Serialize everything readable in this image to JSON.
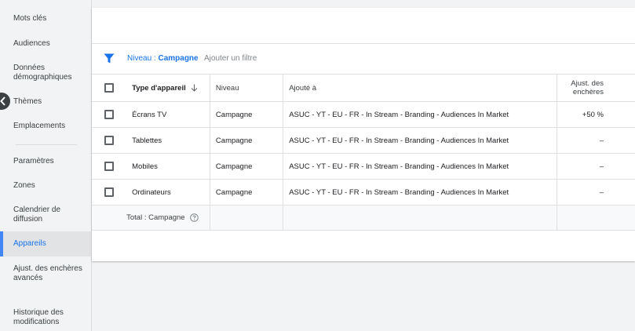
{
  "sidebar": {
    "items": [
      {
        "label": "Mots clés"
      },
      {
        "label": "Audiences"
      },
      {
        "label": "Données démographiques"
      },
      {
        "label": "Thèmes"
      },
      {
        "label": "Emplacements"
      },
      {
        "label": "Paramètres"
      },
      {
        "label": "Zones"
      },
      {
        "label": "Calendrier de diffusion"
      },
      {
        "label": "Appareils"
      },
      {
        "label": "Ajust. des enchères avancés"
      },
      {
        "label": "Historique des modifications"
      }
    ],
    "active": "Appareils",
    "accent_color": "#4285f4"
  },
  "filter": {
    "level_prefix": "Niveau : ",
    "level_value": "Campagne",
    "add_filter": "Ajouter un filtre",
    "icon": "filter-icon"
  },
  "table": {
    "headers": {
      "type": "Type d'appareil",
      "level": "Niveau",
      "added": "Ajouté à",
      "adjust": "Ajust. des enchères"
    },
    "rows": [
      {
        "type": "Écrans TV",
        "level": "Campagne",
        "added": "ASUC - YT - EU - FR - In Stream - Branding - Audiences In Market",
        "adjust": "+50 %"
      },
      {
        "type": "Tablettes",
        "level": "Campagne",
        "added": "ASUC - YT - EU - FR - In Stream - Branding - Audiences In Market",
        "adjust": "–"
      },
      {
        "type": "Mobiles",
        "level": "Campagne",
        "added": "ASUC - YT - EU - FR - In Stream - Branding - Audiences In Market",
        "adjust": "–"
      },
      {
        "type": "Ordinateurs",
        "level": "Campagne",
        "added": "ASUC - YT - EU - FR - In Stream - Branding - Audiences In Market",
        "adjust": "–"
      }
    ],
    "total_label": "Total : Campagne"
  }
}
